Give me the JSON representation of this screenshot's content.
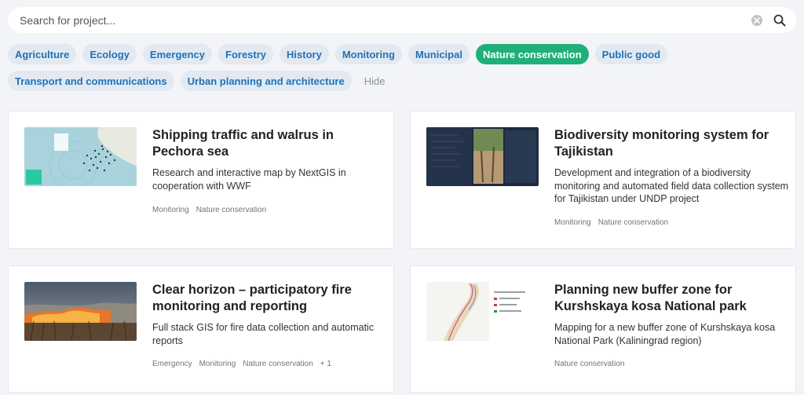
{
  "search": {
    "placeholder": "Search for project...",
    "value": ""
  },
  "tags": [
    {
      "label": "Agriculture",
      "active": false
    },
    {
      "label": "Ecology",
      "active": false
    },
    {
      "label": "Emergency",
      "active": false
    },
    {
      "label": "Forestry",
      "active": false
    },
    {
      "label": "History",
      "active": false
    },
    {
      "label": "Monitoring",
      "active": false
    },
    {
      "label": "Municipal",
      "active": false
    },
    {
      "label": "Nature conservation",
      "active": true
    },
    {
      "label": "Public good",
      "active": false
    },
    {
      "label": "Transport and communications",
      "active": false
    },
    {
      "label": "Urban planning and architecture",
      "active": false
    }
  ],
  "hide_label": "Hide",
  "colors": {
    "accent": "#1fb07a",
    "tag_text": "#1f72b8",
    "tag_bg": "#e3e9f1"
  },
  "projects": [
    {
      "title": "Shipping traffic and walrus in Pechora sea",
      "description": "Research and interactive map by NextGIS in cooperation with WWF",
      "tags": [
        "Monitoring",
        "Nature conservation"
      ]
    },
    {
      "title": "Biodiversity monitoring system for Tajikistan",
      "description": "Development and integration of a biodiversity monitoring and automated field data collection system for Tajikistan under UNDP project",
      "tags": [
        "Monitoring",
        "Nature conservation"
      ]
    },
    {
      "title": "Clear horizon – participatory fire monitoring and reporting",
      "description": "Full stack GIS for fire data collection and automatic reports",
      "tags": [
        "Emergency",
        "Monitoring",
        "Nature conservation",
        "+ 1"
      ]
    },
    {
      "title": "Planning new buffer zone for Kurshskaya kosa National park",
      "description": "Mapping for a new buffer zone of Kurshskaya kosa National Park (Kaliningrad region)",
      "tags": [
        "Nature conservation"
      ]
    }
  ]
}
